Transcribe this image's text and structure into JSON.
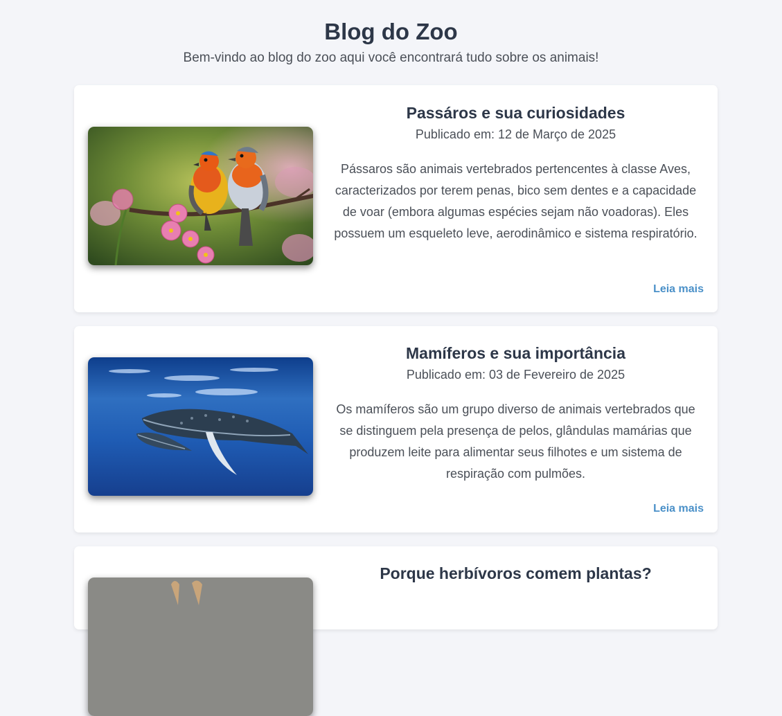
{
  "header": {
    "title": "Blog do Zoo",
    "subtitle": "Bem-vindo ao blog do zoo aqui você encontrará tudo sobre os animais!"
  },
  "posts": [
    {
      "title": "Passáros e sua curiosidades",
      "date": "Publicado em: 12 de Março de 2025",
      "excerpt": "Pássaros são animais vertebrados pertencentes à classe Aves, caracterizados por terem penas, bico sem dentes e a capacidade de voar (embora algumas espécies sejam não voadoras). Eles possuem um esqueleto leve, aerodinâmico e sistema respiratório.",
      "read_more": "Leia mais",
      "image": "birds-on-branch-photo"
    },
    {
      "title": "Mamíferos e sua importância",
      "date": "Publicado em: 03 de Fevereiro de 2025",
      "excerpt": "Os mamíferos são um grupo diverso de animais vertebrados que se distinguem pela presença de pelos, glândulas mamárias que produzem leite para alimentar seus filhotes e um sistema de respiração com pulmões.",
      "read_more": "Leia mais",
      "image": "whale-underwater-photo"
    },
    {
      "title": "Porque herbívoros comem plantas?",
      "image": "herbivore-photo"
    }
  ],
  "colors": {
    "background": "#f4f5f9",
    "card": "#ffffff",
    "heading": "#2d3748",
    "body_text": "#4a4f57",
    "link": "#4a90c8"
  }
}
